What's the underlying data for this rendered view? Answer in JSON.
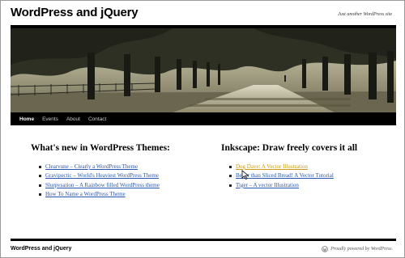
{
  "site": {
    "title": "WordPress and jQuery",
    "tagline": "Just another WordPress site"
  },
  "nav": {
    "items": [
      {
        "label": "Home",
        "active": true
      },
      {
        "label": "Events",
        "active": false
      },
      {
        "label": "About",
        "active": false
      },
      {
        "label": "Contact",
        "active": false
      }
    ]
  },
  "posts": [
    {
      "title": "What's new in WordPress Themes:",
      "links": [
        "Clearvune – Clearly a WordPress Theme",
        "Gravipectic – World's Heaviest WordPress Theme",
        "Slurpvsation – A Rainbow filled WordPress theme",
        "How To Name a WordPress Theme"
      ]
    },
    {
      "title": "Inkscape: Draw freely covers it all",
      "links": [
        "Dog Dave: A Vector Illustration",
        "Better than Sliced Bread! A Vector Tutorial",
        "Tiger – A vector Illustration"
      ],
      "hovered_index": 0
    }
  ],
  "footer": {
    "title": "WordPress and jQuery",
    "credit": "Proudly powered by WordPress."
  },
  "colors": {
    "link": "#2956b2",
    "link_hover": "#c89a17",
    "nav_bg": "#000000"
  },
  "icons": [
    "wordpress-logo-icon",
    "mouse-pointer-icon"
  ]
}
